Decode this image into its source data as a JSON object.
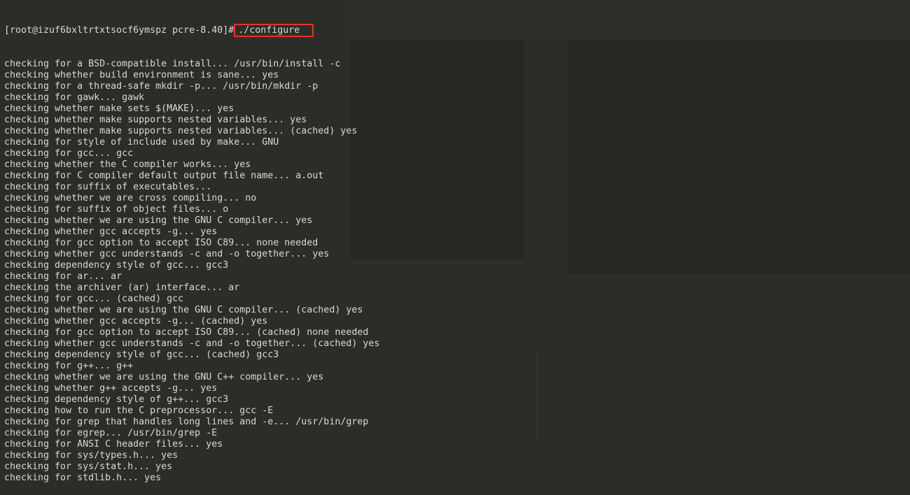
{
  "terminal": {
    "prompt": "[root@izuf6bxltrtxtsocf6ymspz pcre-8.40]#",
    "command": "./configure",
    "highlight_color": "#e8312f",
    "output": [
      "checking for a BSD-compatible install... /usr/bin/install -c",
      "checking whether build environment is sane... yes",
      "checking for a thread-safe mkdir -p... /usr/bin/mkdir -p",
      "checking for gawk... gawk",
      "checking whether make sets $(MAKE)... yes",
      "checking whether make supports nested variables... yes",
      "checking whether make supports nested variables... (cached) yes",
      "checking for style of include used by make... GNU",
      "checking for gcc... gcc",
      "checking whether the C compiler works... yes",
      "checking for C compiler default output file name... a.out",
      "checking for suffix of executables... ",
      "checking whether we are cross compiling... no",
      "checking for suffix of object files... o",
      "checking whether we are using the GNU C compiler... yes",
      "checking whether gcc accepts -g... yes",
      "checking for gcc option to accept ISO C89... none needed",
      "checking whether gcc understands -c and -o together... yes",
      "checking dependency style of gcc... gcc3",
      "checking for ar... ar",
      "checking the archiver (ar) interface... ar",
      "checking for gcc... (cached) gcc",
      "checking whether we are using the GNU C compiler... (cached) yes",
      "checking whether gcc accepts -g... (cached) yes",
      "checking for gcc option to accept ISO C89... (cached) none needed",
      "checking whether gcc understands -c and -o together... (cached) yes",
      "checking dependency style of gcc... (cached) gcc3",
      "checking for g++... g++",
      "checking whether we are using the GNU C++ compiler... yes",
      "checking whether g++ accepts -g... yes",
      "checking dependency style of g++... gcc3",
      "checking how to run the C preprocessor... gcc -E",
      "checking for grep that handles long lines and -e... /usr/bin/grep",
      "checking for egrep... /usr/bin/grep -E",
      "checking for ANSI C header files... yes",
      "checking for sys/types.h... yes",
      "checking for sys/stat.h... yes",
      "checking for stdlib.h... yes"
    ]
  }
}
